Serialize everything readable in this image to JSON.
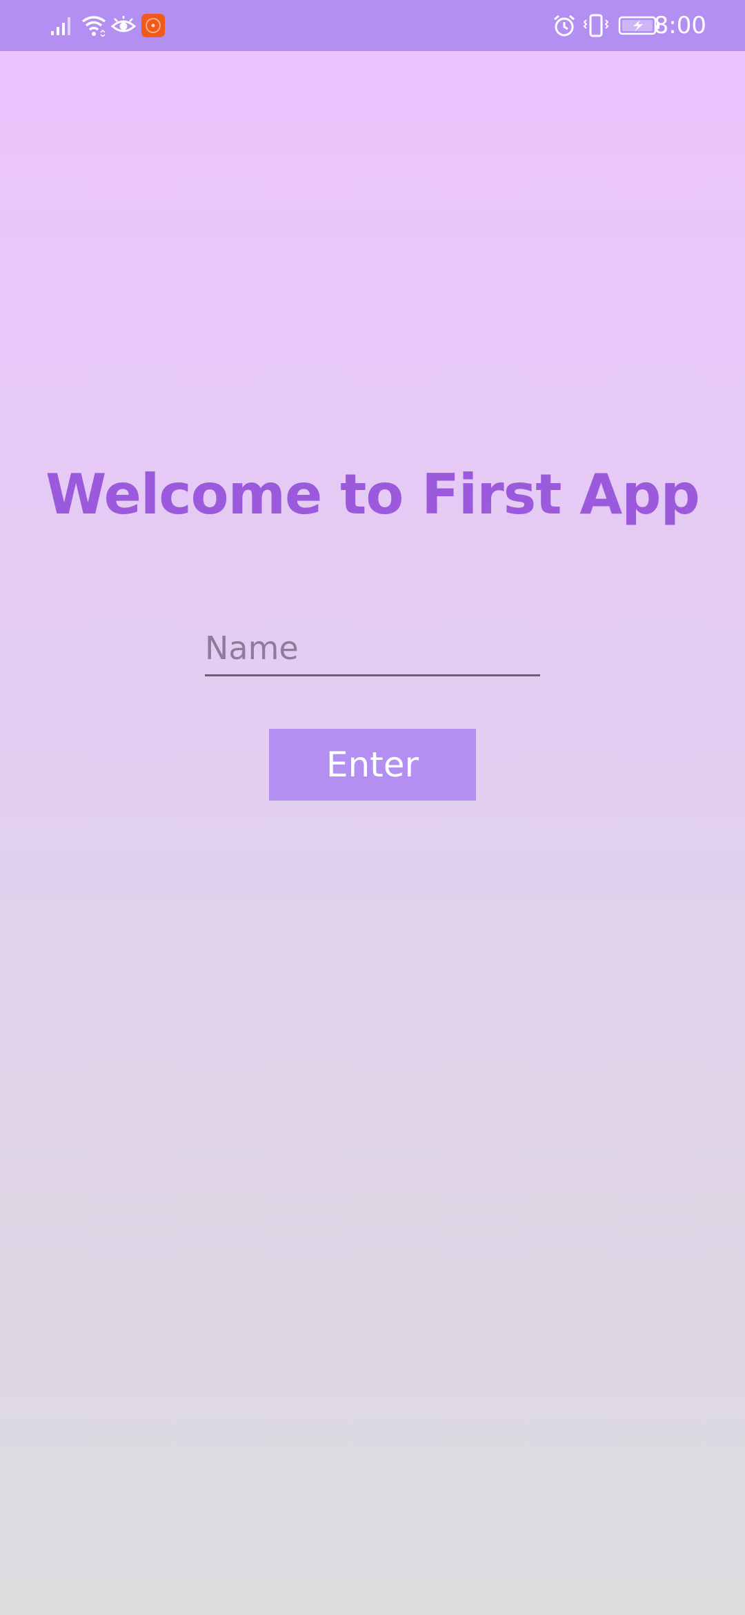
{
  "status_bar": {
    "time": "8:00",
    "background_color": "#b38ff2",
    "left_icons": [
      "signal-icon",
      "wifi-icon",
      "eye-icon",
      "app-notification-icon"
    ],
    "right_icons": [
      "alarm-icon",
      "vibrate-icon",
      "battery-charging-icon"
    ]
  },
  "main": {
    "title": "Welcome to First App",
    "name_input": {
      "placeholder": "Name",
      "value": ""
    },
    "enter_button_label": "Enter"
  },
  "colors": {
    "accent": "#b38ff2",
    "title": "#9b59dc",
    "gradient_top": "#ecc3ff",
    "gradient_bottom": "#dcdcde"
  }
}
